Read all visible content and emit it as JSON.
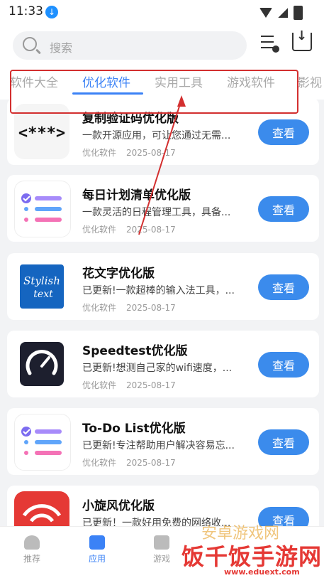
{
  "status": {
    "time": "11:33"
  },
  "search": {
    "placeholder": "搜索"
  },
  "tabs": [
    {
      "label": "软件大全",
      "active": false
    },
    {
      "label": "优化软件",
      "active": true
    },
    {
      "label": "实用工具",
      "active": false
    },
    {
      "label": "游戏软件",
      "active": false
    },
    {
      "label": "影视",
      "active": false
    }
  ],
  "apps": [
    {
      "title": "复制验证码优化版",
      "desc": "一款开源应用，可让您通过无需...",
      "category": "优化软件",
      "date": "2025-08-17",
      "button": "查看",
      "icon": "code-icon"
    },
    {
      "title": "每日计划清单优化版",
      "desc": "一款灵活的日程管理工具，具备...",
      "category": "优化软件",
      "date": "2025-08-17",
      "button": "查看",
      "icon": "checklist-icon"
    },
    {
      "title": "花文字优化版",
      "desc": "已更新!一款超棒的输入法工具，...",
      "category": "优化软件",
      "date": "2025-08-17",
      "button": "查看",
      "icon": "stylish-text-icon"
    },
    {
      "title": "Speedtest优化版",
      "desc": "已更新!想测自己家的wifi速度，...",
      "category": "优化软件",
      "date": "2025-08-17",
      "button": "查看",
      "icon": "speedometer-icon"
    },
    {
      "title": "To-Do List优化版",
      "desc": "已更新!专注帮助用户解决容易忘...",
      "category": "优化软件",
      "date": "2025-08-17",
      "button": "查看",
      "icon": "checklist-icon"
    },
    {
      "title": "小旋风优化版",
      "desc": "已更新！一款好用免费的网络收...",
      "category": "",
      "date": "",
      "button": "查看",
      "icon": "5m-icon"
    }
  ],
  "nav": [
    {
      "label": "推荐",
      "active": false
    },
    {
      "label": "应用",
      "active": true
    },
    {
      "label": "游戏",
      "active": false
    }
  ],
  "watermark": {
    "main": "饭千饭手游网",
    "url": "www.eduext.com",
    "faint": "安卓游戏网"
  },
  "colors": {
    "accent": "#3b82f6",
    "button": "#3b8bec",
    "annotation": "#d32f2f"
  }
}
